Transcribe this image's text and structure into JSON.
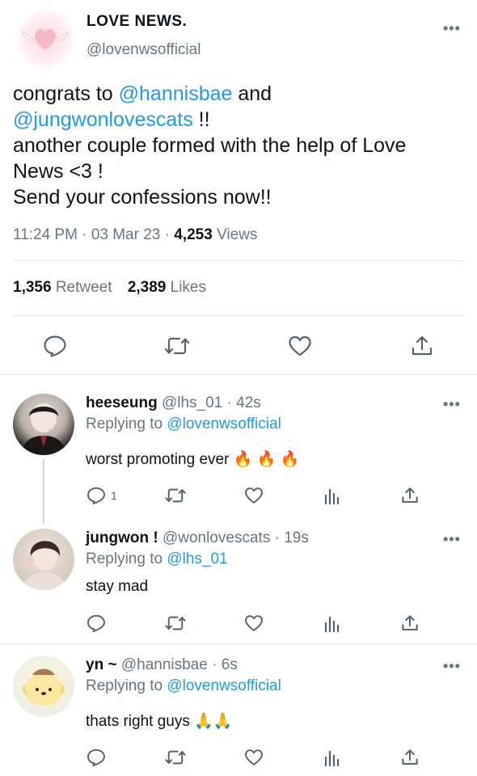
{
  "main_tweet": {
    "name": "LOVE NEWS.",
    "handle": "@lovenwsofficial",
    "text": {
      "t1": "congrats to ",
      "mention1": "@hannisbae",
      "t2": " and",
      "mention2": "@jungwonlovescats",
      "t3": " !!",
      "line3": "another couple formed with the help of Love",
      "line4": "News <3 !",
      "line5": "Send your confessions now!!"
    },
    "time": "11:24 PM",
    "date": "03 Mar 23",
    "views_count": "4,253",
    "views_label": "Views",
    "retweets_count": "1,356",
    "retweets_label": "Retweet",
    "likes_count": "2,389",
    "likes_label": "Likes"
  },
  "replies": [
    {
      "name": "heeseung",
      "handle": "@lhs_01",
      "time": "42s",
      "replying_label": "Replying to",
      "replying_to": "@lovenwsofficial",
      "text": "worst promoting ever",
      "emoji": "🔥 🔥 🔥",
      "reply_count": "1"
    },
    {
      "name": "jungwon !",
      "handle": "@wonlovescats",
      "time": "19s",
      "replying_label": "Replying to",
      "replying_to": "@lhs_01",
      "text": "stay mad",
      "emoji": "",
      "reply_count": ""
    },
    {
      "name": "yn ~",
      "handle": "@hannisbae",
      "time": "6s",
      "replying_label": "Replying to",
      "replying_to": "@lovenwsofficial",
      "text": "thats right guys",
      "emoji": "🙏🙏",
      "reply_count": ""
    }
  ],
  "separator": "·",
  "icons": {
    "reply": "reply-icon",
    "retweet": "retweet-icon",
    "like": "heart-icon",
    "share": "share-icon",
    "analytics": "analytics-icon",
    "more": "more-icon"
  },
  "colors": {
    "link": "#1d9bf0",
    "secondary_text": "#657786",
    "divider": "#e1e8ed"
  }
}
